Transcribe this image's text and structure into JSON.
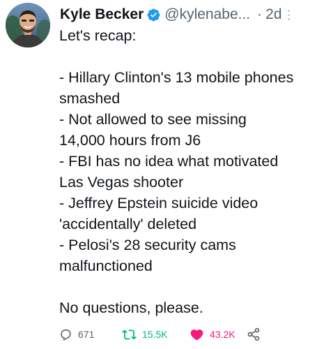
{
  "author": {
    "display_name": "Kyle Becker",
    "handle": "@kylenabe...",
    "separator": "·",
    "time": "2d",
    "verified": true
  },
  "tweet": {
    "lines": [
      "Let's recap:",
      "",
      "- Hillary Clinton's 13 mobile phones",
      "smashed",
      "- Not allowed to see missing",
      "14,000 hours from J6",
      "- FBI has no idea what motivated",
      "Las Vegas shooter",
      "- Jeffrey Epstein suicide video",
      "'accidentally' deleted",
      "- Pelosi's 28 security cams",
      "malfunctioned",
      "",
      "No questions, please."
    ]
  },
  "actions": {
    "reply": {
      "icon": "reply-icon",
      "count": "671"
    },
    "retweet": {
      "icon": "retweet-icon",
      "count": "15.5K",
      "color": "#00ba7c"
    },
    "like": {
      "icon": "heart-icon",
      "count": "43.2K",
      "color": "#f91880"
    },
    "share": {
      "icon": "share-icon"
    }
  },
  "colors": {
    "text": "#0f1419",
    "secondary": "#536471",
    "verified": "#1d9bf0"
  }
}
